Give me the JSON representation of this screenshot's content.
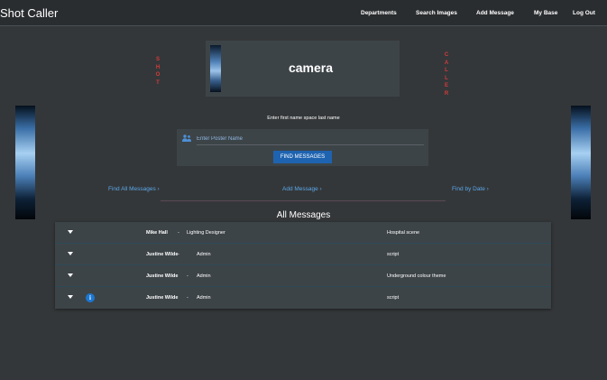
{
  "header": {
    "brand": "Shot Caller",
    "nav": [
      "Departments",
      "Search Images",
      "Add Message",
      "My Base",
      "Log Out"
    ]
  },
  "decor": {
    "left_word": [
      "S",
      "H",
      "O",
      "T"
    ],
    "right_word": [
      "C",
      "A",
      "L",
      "L",
      "E",
      "R"
    ]
  },
  "department": {
    "title": "camera"
  },
  "search": {
    "prompt": "Enter first name space last name",
    "placeholder": "Enter Poster Name",
    "button_label": "FIND MESSAGES",
    "icon": "people-icon"
  },
  "links": {
    "find_all": "Find All Messages ›",
    "add_message": "Add Message ›",
    "find_by_date": "Find by Date ›"
  },
  "messages": {
    "title": "All Messages",
    "rows": [
      {
        "name": "Mike Hall",
        "dash": "-",
        "role": "Lighting Designer",
        "subject": "Hospital scene",
        "has_info": false
      },
      {
        "name": "Justine Wilde",
        "dash": "-",
        "role": "Admin",
        "subject": "script",
        "has_info": false
      },
      {
        "name": "Justine Wilde",
        "dash": "-",
        "role": "Admin",
        "subject": "Underground colour theme",
        "has_info": false
      },
      {
        "name": "Justine Wilde",
        "dash": "-",
        "role": "Admin",
        "subject": "script",
        "has_info": true,
        "info_glyph": "i"
      }
    ]
  },
  "colors": {
    "accent": "#1e63b0",
    "link": "#5aa8ea",
    "decor_red": "#d23b3b",
    "background": "#343739",
    "panel": "#3d4448"
  }
}
